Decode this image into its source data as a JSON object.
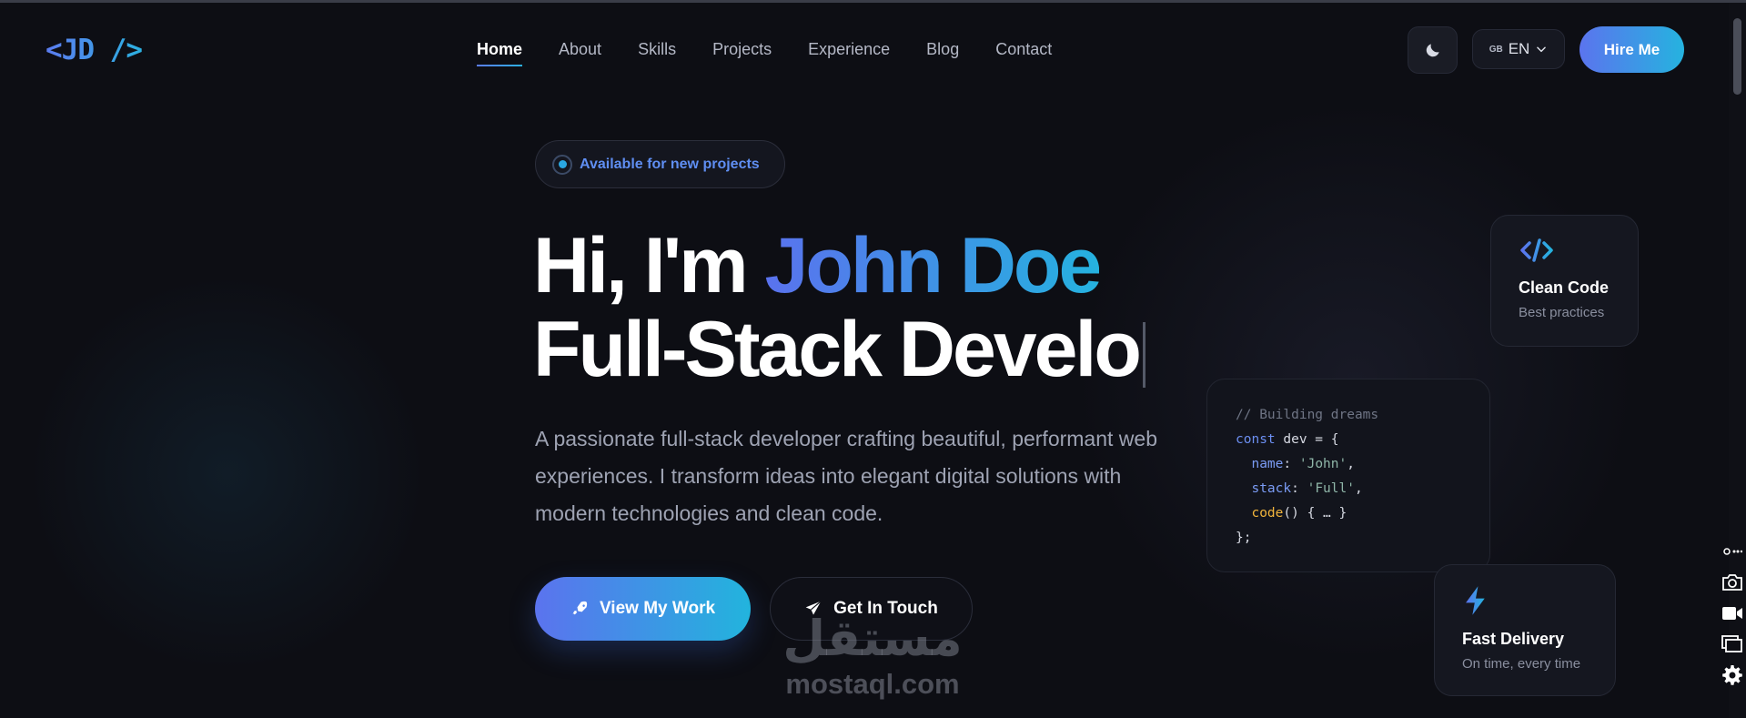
{
  "nav": {
    "logo": "<JD />",
    "links": [
      "Home",
      "About",
      "Skills",
      "Projects",
      "Experience",
      "Blog",
      "Contact"
    ],
    "active": "Home",
    "theme_icon": "moon-icon",
    "lang_flag": "GB",
    "lang_label": "EN",
    "hire_label": "Hire Me"
  },
  "hero": {
    "badge": "Available for new projects",
    "greeting": "Hi, I'm ",
    "name": "John Doe",
    "role_typed": "Full-Stack Develo",
    "description": "A passionate full-stack developer crafting beautiful, performant web experiences. I transform ideas into elegant digital solutions with modern technologies and clean code.",
    "primary_button": "View My Work",
    "secondary_button": "Get In Touch"
  },
  "cards": {
    "clean": {
      "title": "Clean Code",
      "subtitle": "Best practices",
      "icon": "code-icon"
    },
    "fast": {
      "title": "Fast Delivery",
      "subtitle": "On time, every time",
      "icon": "lightning-icon"
    }
  },
  "code": {
    "comment": "// Building dreams",
    "const_kw": "const",
    "var_decl": " dev = {",
    "name_key": "name",
    "name_val": "'John'",
    "stack_key": "stack",
    "stack_val": "'Full'",
    "fn_name": "code",
    "fn_rest": "() { … }",
    "close": "};"
  },
  "watermark": {
    "arabic": "مستقل",
    "latin": "mostaql.com"
  },
  "colors": {
    "accent_start": "#5b74ee",
    "accent_end": "#25b3df",
    "background": "#0d0e14"
  }
}
